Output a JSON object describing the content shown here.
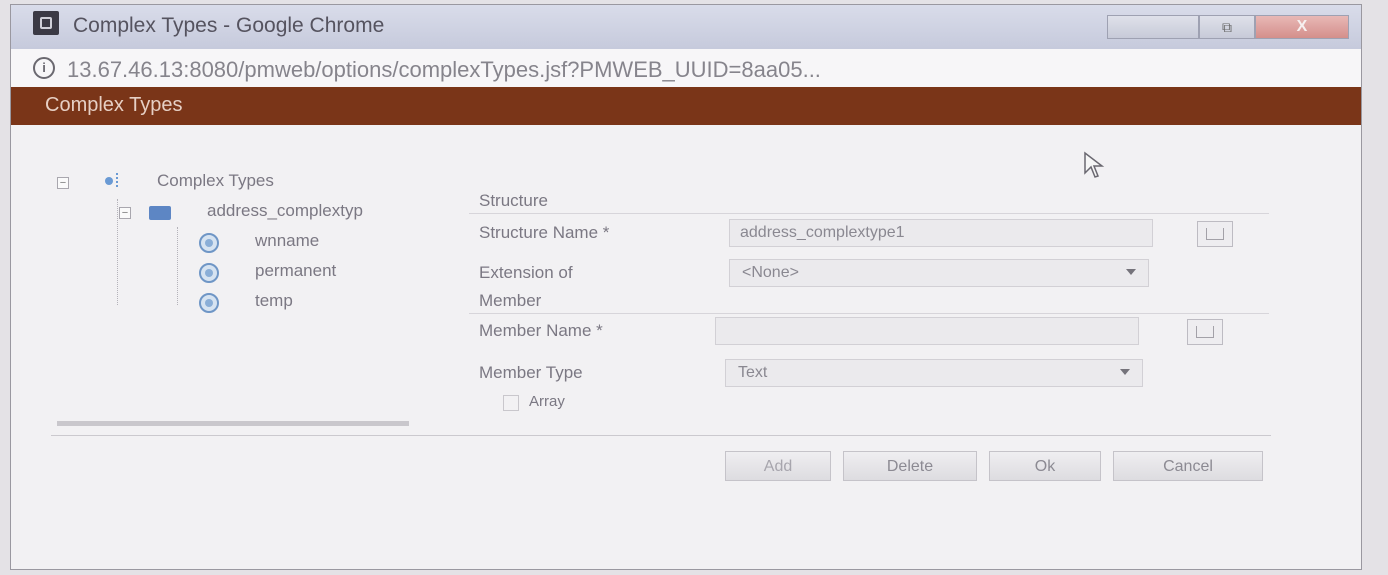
{
  "window": {
    "title": "Complex Types - Google Chrome",
    "controls": {
      "minimize": "",
      "maximize": "⧉",
      "close": "X"
    }
  },
  "addressbar": {
    "url": "13.67.46.13:8080/pmweb/options/complexTypes.jsf?PMWEB_UUID=8aa05..."
  },
  "dialog": {
    "title": "Complex Types"
  },
  "tree": {
    "root_label": "Complex Types",
    "child_label": "address_complextyp",
    "members": [
      {
        "label": "wnname"
      },
      {
        "label": "permanent"
      },
      {
        "label": "temp"
      }
    ]
  },
  "form": {
    "structure_section": "Structure",
    "structure_name_label": "Structure Name *",
    "structure_name_value": "address_complextype1",
    "extension_label": "Extension of",
    "extension_value": "<None>",
    "member_section": "Member",
    "member_name_label": "Member Name *",
    "member_name_value": "",
    "member_type_label": "Member Type",
    "member_type_value": "Text",
    "array_label": "Array",
    "array_checked": false
  },
  "buttons": {
    "add": "Add",
    "delete": "Delete",
    "ok": "Ok",
    "cancel": "Cancel"
  },
  "colors": {
    "header_bar": "#7a3518",
    "titlebar": "#c6cadc",
    "close_button": "#d48f8b"
  }
}
